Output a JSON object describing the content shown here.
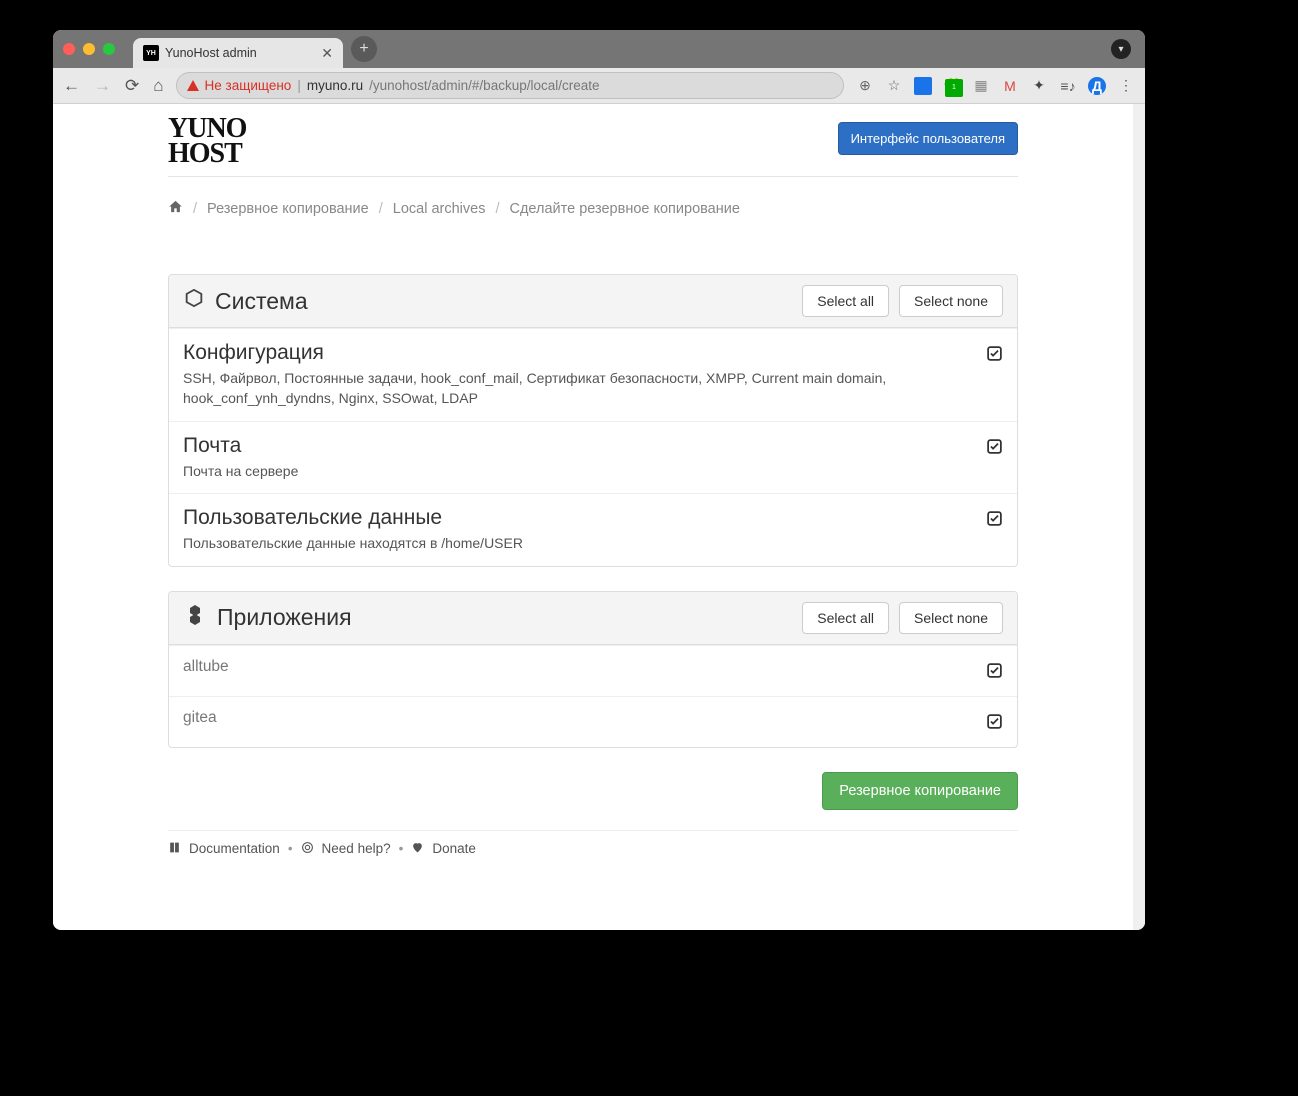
{
  "browser": {
    "tab_title": "YunoHost admin",
    "favicon_text": "YH",
    "not_secure": "Не защищено",
    "url_host": "myuno.ru",
    "url_path": "/yunohost/admin/#/backup/local/create",
    "avatar_letter": "Д"
  },
  "header": {
    "logo_line1": "YUNO",
    "logo_line2": "HOST",
    "user_interface_btn": "Интерфейс пользователя"
  },
  "breadcrumb": {
    "backup": "Резервное копирование",
    "local_archives": "Local archives",
    "create": "Сделайте резервное копирование"
  },
  "system": {
    "title": "Система",
    "select_all": "Select all",
    "select_none": "Select none",
    "items": [
      {
        "title": "Конфигурация",
        "desc": "SSH, Файрвол, Постоянные задачи, hook_conf_mail, Сертификат безопасности, XMPP, Current main domain, hook_conf_ynh_dyndns, Nginx, SSOwat, LDAP"
      },
      {
        "title": "Почта",
        "desc": "Почта на сервере"
      },
      {
        "title": "Пользовательские данные",
        "desc": "Пользовательские данные находятся в /home/USER"
      }
    ]
  },
  "apps": {
    "title": "Приложения",
    "select_all": "Select all",
    "select_none": "Select none",
    "items": [
      {
        "title": "alltube"
      },
      {
        "title": "gitea"
      }
    ]
  },
  "action_button": "Резервное копирование",
  "footer": {
    "doc": "Documentation",
    "help": "Need help?",
    "donate": "Donate"
  }
}
